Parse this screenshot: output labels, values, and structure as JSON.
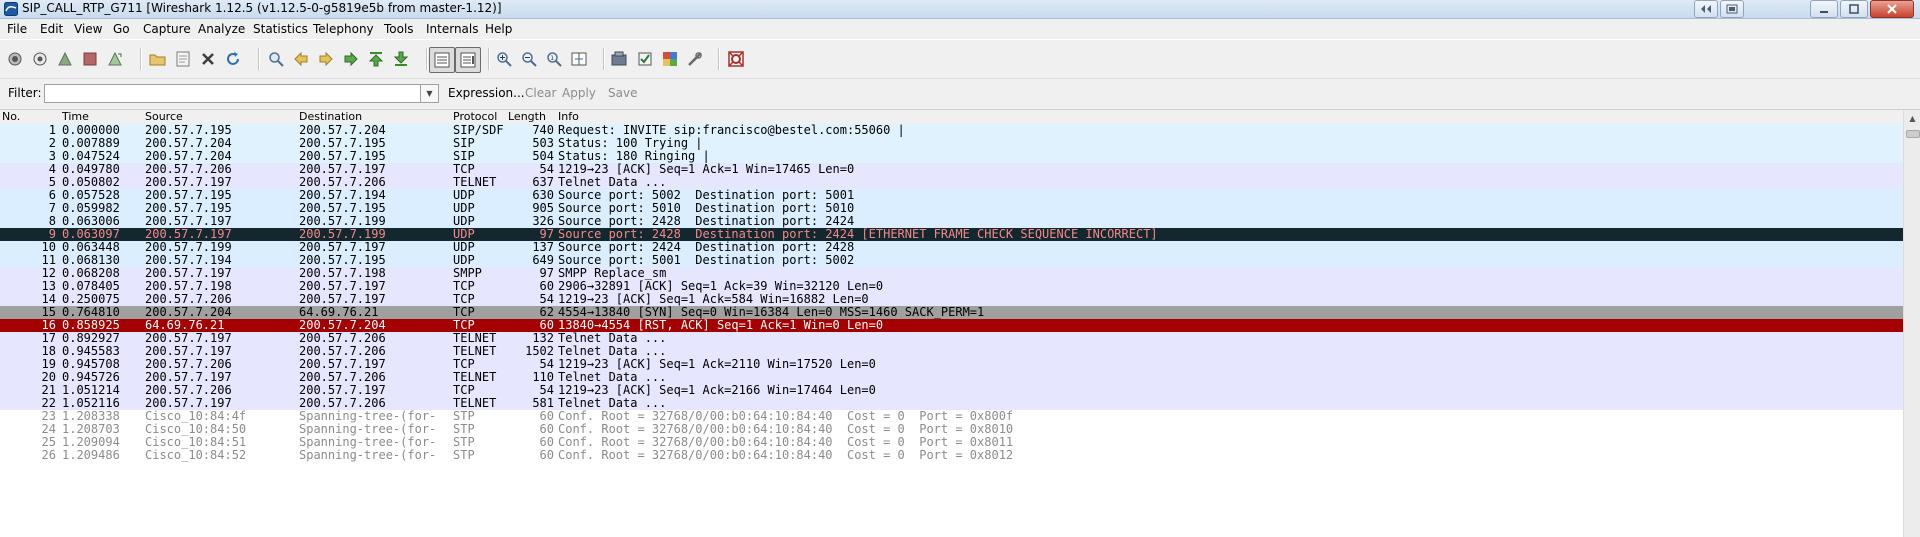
{
  "window": {
    "title": "SIP_CALL_RTP_G711  [Wireshark 1.12.5  (v1.12.5-0-g5819e5b from master-1.12)]"
  },
  "menu": [
    "File",
    "Edit",
    "View",
    "Go",
    "Capture",
    "Analyze",
    "Statistics",
    "Telephony",
    "Tools",
    "Internals",
    "Help"
  ],
  "filter": {
    "label": "Filter:",
    "value": "",
    "expression": "Expression...",
    "clear": "Clear",
    "apply": "Apply",
    "save": "Save"
  },
  "columns": {
    "no": "No.",
    "time": "Time",
    "source": "Source",
    "destination": "Destination",
    "protocol": "Protocol",
    "length": "Length",
    "info": "Info"
  },
  "colors": {
    "sip": "#e1f2ff",
    "tcp": "#e7e6ff",
    "udp": "#daeeff",
    "telnet": "#e7e6ff",
    "smpp": "#e7e6ff",
    "checksum_error_bg": "#12272e",
    "checksum_error_fg": "#f78787",
    "syn_bg": "#a0a0a0",
    "rst_bg": "#a40000",
    "stp_fg": "#8c8c8c"
  },
  "packets": [
    {
      "no": "1",
      "time": "0.000000",
      "src": "200.57.7.195",
      "dst": "200.57.7.204",
      "proto": "SIP/SDF",
      "len": "740",
      "info": "Request: INVITE sip:francisco@bestel.com:55060 |",
      "style": "sip"
    },
    {
      "no": "2",
      "time": "0.007889",
      "src": "200.57.7.204",
      "dst": "200.57.7.195",
      "proto": "SIP",
      "len": "503",
      "info": "Status: 100 Trying |",
      "style": "sip"
    },
    {
      "no": "3",
      "time": "0.047524",
      "src": "200.57.7.204",
      "dst": "200.57.7.195",
      "proto": "SIP",
      "len": "504",
      "info": "Status: 180 Ringing |",
      "style": "sip"
    },
    {
      "no": "4",
      "time": "0.049780",
      "src": "200.57.7.206",
      "dst": "200.57.7.197",
      "proto": "TCP",
      "len": "54",
      "info": "1219→23 [ACK] Seq=1 Ack=1 Win=17465 Len=0",
      "style": "tcp"
    },
    {
      "no": "5",
      "time": "0.050802",
      "src": "200.57.7.197",
      "dst": "200.57.7.206",
      "proto": "TELNET",
      "len": "637",
      "info": "Telnet Data ...",
      "style": "tcp"
    },
    {
      "no": "6",
      "time": "0.057528",
      "src": "200.57.7.195",
      "dst": "200.57.7.194",
      "proto": "UDP",
      "len": "630",
      "info": "Source port: 5002  Destination port: 5001",
      "style": "udp"
    },
    {
      "no": "7",
      "time": "0.059982",
      "src": "200.57.7.195",
      "dst": "200.57.7.195",
      "proto": "UDP",
      "len": "905",
      "info": "Source port: 5010  Destination port: 5010",
      "style": "udp"
    },
    {
      "no": "8",
      "time": "0.063006",
      "src": "200.57.7.197",
      "dst": "200.57.7.199",
      "proto": "UDP",
      "len": "326",
      "info": "Source port: 2428  Destination port: 2424",
      "style": "udp"
    },
    {
      "no": "9",
      "time": "0.063097",
      "src": "200.57.7.197",
      "dst": "200.57.7.199",
      "proto": "UDP",
      "len": "97",
      "info": "Source port: 2428  Destination port: 2424 [ETHERNET FRAME CHECK SEQUENCE INCORRECT]",
      "style": "err"
    },
    {
      "no": "10",
      "time": "0.063448",
      "src": "200.57.7.199",
      "dst": "200.57.7.197",
      "proto": "UDP",
      "len": "137",
      "info": "Source port: 2424  Destination port: 2428",
      "style": "udp"
    },
    {
      "no": "11",
      "time": "0.068130",
      "src": "200.57.7.194",
      "dst": "200.57.7.195",
      "proto": "UDP",
      "len": "649",
      "info": "Source port: 5001  Destination port: 5002",
      "style": "udp"
    },
    {
      "no": "12",
      "time": "0.068208",
      "src": "200.57.7.197",
      "dst": "200.57.7.198",
      "proto": "SMPP",
      "len": "97",
      "info": "SMPP Replace_sm",
      "style": "tcp"
    },
    {
      "no": "13",
      "time": "0.078405",
      "src": "200.57.7.198",
      "dst": "200.57.7.197",
      "proto": "TCP",
      "len": "60",
      "info": "2906→32891 [ACK] Seq=1 Ack=39 Win=32120 Len=0",
      "style": "tcp"
    },
    {
      "no": "14",
      "time": "0.250075",
      "src": "200.57.7.206",
      "dst": "200.57.7.197",
      "proto": "TCP",
      "len": "54",
      "info": "1219→23 [ACK] Seq=1 Ack=584 Win=16882 Len=0",
      "style": "tcp"
    },
    {
      "no": "15",
      "time": "0.764810",
      "src": "200.57.7.204",
      "dst": "64.69.76.21",
      "proto": "TCP",
      "len": "62",
      "info": "4554→13840 [SYN] Seq=0 Win=16384 Len=0 MSS=1460 SACK_PERM=1",
      "style": "syn"
    },
    {
      "no": "16",
      "time": "0.858925",
      "src": "64.69.76.21",
      "dst": "200.57.7.204",
      "proto": "TCP",
      "len": "60",
      "info": "13840→4554 [RST, ACK] Seq=1 Ack=1 Win=0 Len=0",
      "style": "rst"
    },
    {
      "no": "17",
      "time": "0.892927",
      "src": "200.57.7.197",
      "dst": "200.57.7.206",
      "proto": "TELNET",
      "len": "132",
      "info": "Telnet Data ...",
      "style": "tcp"
    },
    {
      "no": "18",
      "time": "0.945583",
      "src": "200.57.7.197",
      "dst": "200.57.7.206",
      "proto": "TELNET",
      "len": "1502",
      "info": "Telnet Data ...",
      "style": "tcp"
    },
    {
      "no": "19",
      "time": "0.945708",
      "src": "200.57.7.206",
      "dst": "200.57.7.197",
      "proto": "TCP",
      "len": "54",
      "info": "1219→23 [ACK] Seq=1 Ack=2110 Win=17520 Len=0",
      "style": "tcp"
    },
    {
      "no": "20",
      "time": "0.945726",
      "src": "200.57.7.197",
      "dst": "200.57.7.206",
      "proto": "TELNET",
      "len": "110",
      "info": "Telnet Data ...",
      "style": "tcp"
    },
    {
      "no": "21",
      "time": "1.051214",
      "src": "200.57.7.206",
      "dst": "200.57.7.197",
      "proto": "TCP",
      "len": "54",
      "info": "1219→23 [ACK] Seq=1 Ack=2166 Win=17464 Len=0",
      "style": "tcp"
    },
    {
      "no": "22",
      "time": "1.052116",
      "src": "200.57.7.197",
      "dst": "200.57.7.206",
      "proto": "TELNET",
      "len": "581",
      "info": "Telnet Data ...",
      "style": "tcp"
    },
    {
      "no": "23",
      "time": "1.208338",
      "src": "Cisco_10:84:4f",
      "dst": "Spanning-tree-(for-",
      "proto": "STP",
      "len": "60",
      "info": "Conf. Root = 32768/0/00:b0:64:10:84:40  Cost = 0  Port = 0x800f",
      "style": "stp"
    },
    {
      "no": "24",
      "time": "1.208703",
      "src": "Cisco_10:84:50",
      "dst": "Spanning-tree-(for-",
      "proto": "STP",
      "len": "60",
      "info": "Conf. Root = 32768/0/00:b0:64:10:84:40  Cost = 0  Port = 0x8010",
      "style": "stp"
    },
    {
      "no": "25",
      "time": "1.209094",
      "src": "Cisco_10:84:51",
      "dst": "Spanning-tree-(for-",
      "proto": "STP",
      "len": "60",
      "info": "Conf. Root = 32768/0/00:b0:64:10:84:40  Cost = 0  Port = 0x8011",
      "style": "stp"
    },
    {
      "no": "26",
      "time": "1.209486",
      "src": "Cisco_10:84:52",
      "dst": "Spanning-tree-(for-",
      "proto": "STP",
      "len": "60",
      "info": "Conf. Root = 32768/0/00:b0:64:10:84:40  Cost = 0  Port = 0x8012",
      "style": "stp"
    }
  ]
}
